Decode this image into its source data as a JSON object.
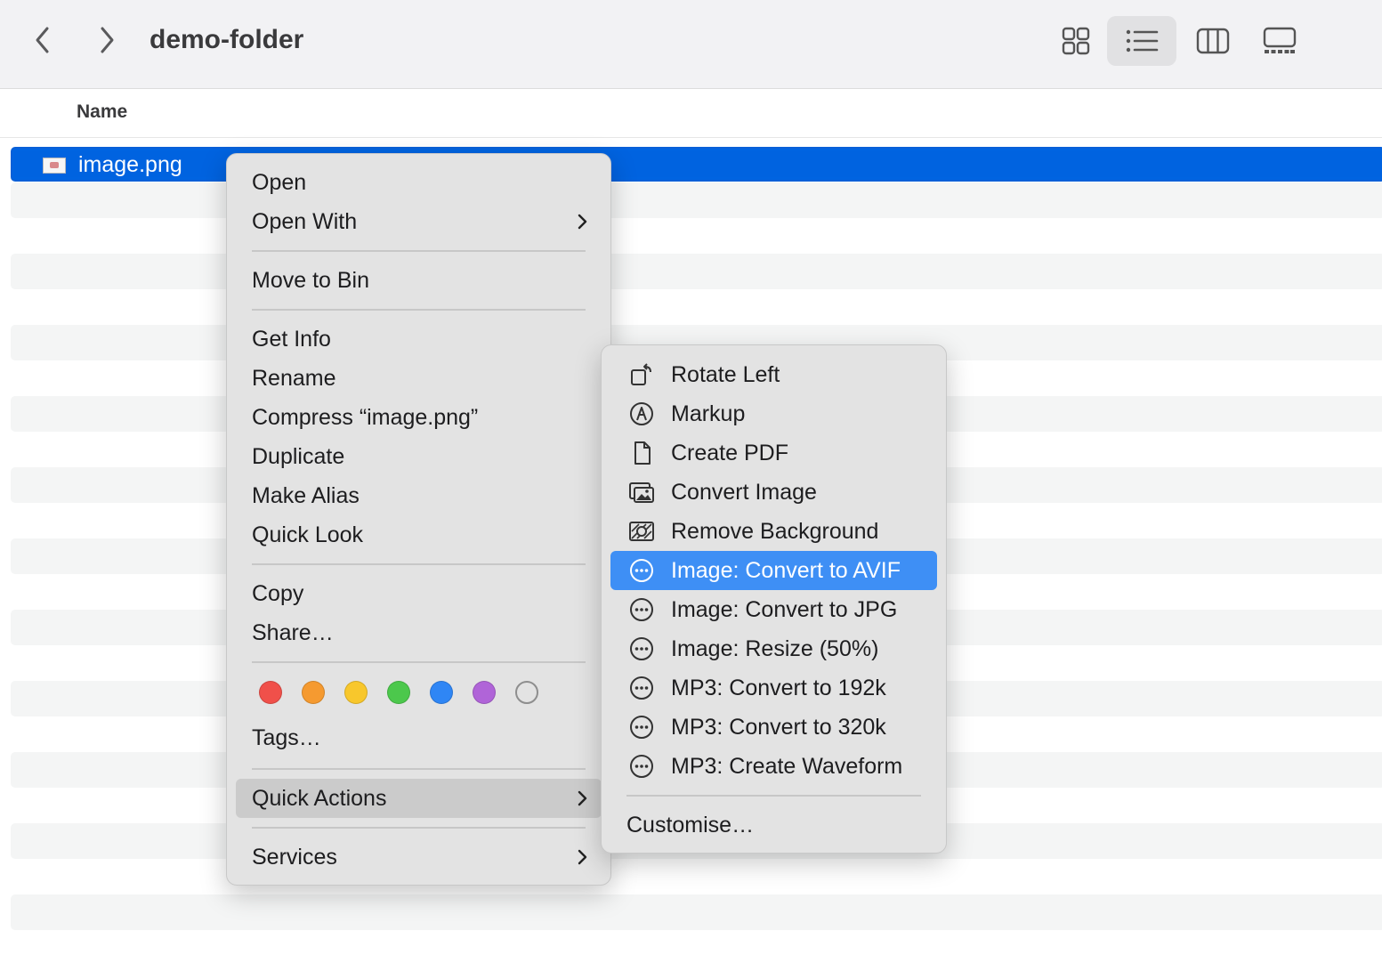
{
  "window": {
    "folder_title": "demo-folder"
  },
  "header": {
    "name_column": "Name"
  },
  "file": {
    "name": "image.png"
  },
  "context_menu": {
    "items": [
      {
        "label": "Open"
      },
      {
        "label": "Open With"
      },
      {
        "label": "Move to Bin"
      },
      {
        "label": "Get Info"
      },
      {
        "label": "Rename"
      },
      {
        "label": "Compress “image.png”"
      },
      {
        "label": "Duplicate"
      },
      {
        "label": "Make Alias"
      },
      {
        "label": "Quick Look"
      },
      {
        "label": "Copy"
      },
      {
        "label": "Share…"
      },
      {
        "label": "Tags…"
      },
      {
        "label": "Quick Actions"
      },
      {
        "label": "Services"
      }
    ],
    "tag_colors": [
      "#f0504a",
      "#f59a30",
      "#f8c72c",
      "#4cc84c",
      "#2f86f5",
      "#b064d8",
      "none"
    ]
  },
  "quick_actions": {
    "items": [
      {
        "label": "Rotate Left",
        "icon": "rotate-left-icon"
      },
      {
        "label": "Markup",
        "icon": "markup-icon"
      },
      {
        "label": "Create PDF",
        "icon": "document-icon"
      },
      {
        "label": "Convert Image",
        "icon": "photo-stack-icon"
      },
      {
        "label": "Remove Background",
        "icon": "remove-background-icon"
      },
      {
        "label": "Image: Convert to AVIF",
        "icon": "ellipsis-circle-icon"
      },
      {
        "label": "Image: Convert to JPG",
        "icon": "ellipsis-circle-icon"
      },
      {
        "label": "Image: Resize (50%)",
        "icon": "ellipsis-circle-icon"
      },
      {
        "label": "MP3: Convert to 192k",
        "icon": "ellipsis-circle-icon"
      },
      {
        "label": "MP3: Convert to 320k",
        "icon": "ellipsis-circle-icon"
      },
      {
        "label": "MP3: Create Waveform",
        "icon": "ellipsis-circle-icon"
      }
    ],
    "customise_label": "Customise…"
  },
  "colors": {
    "selection": "#0064e1",
    "highlight": "#3e8ff5"
  }
}
